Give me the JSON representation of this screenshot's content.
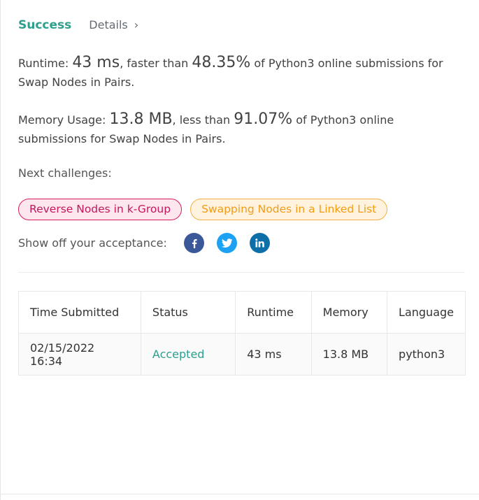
{
  "result": {
    "status": "Success",
    "details_label": "Details",
    "chevron": "›"
  },
  "runtime": {
    "label": "Runtime: ",
    "value": "43 ms",
    "comparison_prefix": ", faster than ",
    "percent": "48.35%",
    "suffix": " of Python3 online submissions for Swap Nodes in Pairs."
  },
  "memory": {
    "label": "Memory Usage: ",
    "value": "13.8 MB",
    "comparison_prefix": ", less than ",
    "percent": "91.07%",
    "suffix": " of Python3 online submissions for Swap Nodes in Pairs."
  },
  "next_challenges": {
    "label": "Next challenges:",
    "items": [
      {
        "title": "Reverse Nodes in k-Group",
        "difficulty_color": "#c2185b"
      },
      {
        "title": "Swapping Nodes in a Linked List",
        "difficulty_color": "#f39c12"
      }
    ]
  },
  "share": {
    "label": "Show off your acceptance:",
    "icons": [
      "facebook-icon",
      "twitter-icon",
      "linkedin-icon"
    ]
  },
  "submissions": {
    "columns": [
      "Time Submitted",
      "Status",
      "Runtime",
      "Memory",
      "Language"
    ],
    "rows": [
      {
        "time_submitted": "02/15/2022 16:34",
        "status": "Accepted",
        "runtime": "43 ms",
        "memory": "13.8 MB",
        "language": "python3"
      }
    ]
  },
  "colors": {
    "accent_green": "#2e9f8c",
    "facebook": "#3b5998",
    "twitter": "#1da1f2",
    "linkedin": "#0e6fa8"
  }
}
